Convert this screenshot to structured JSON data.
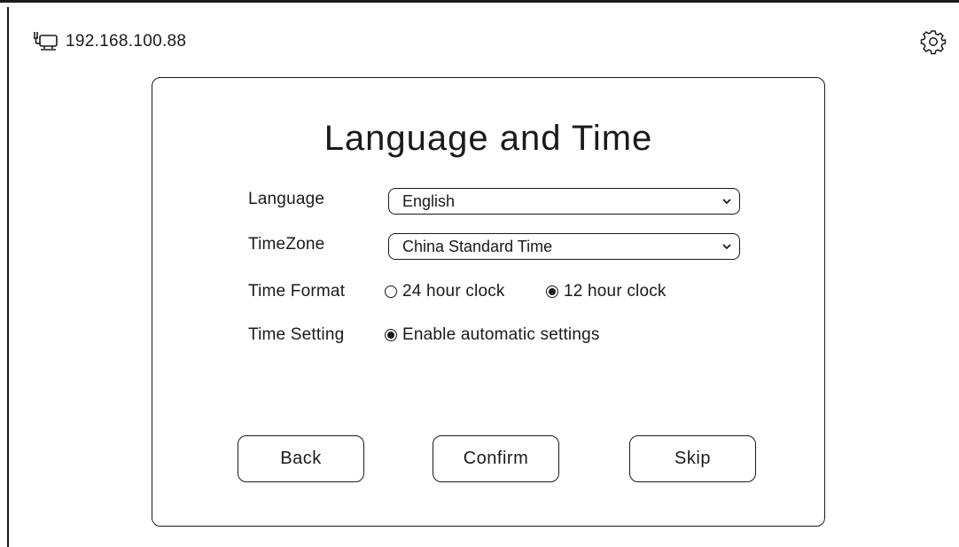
{
  "header": {
    "ip_address": "192.168.100.88",
    "network_icon": "wired-network-icon",
    "settings_icon": "gear-icon"
  },
  "dialog": {
    "title": "Language and Time",
    "language": {
      "label": "Language",
      "value": "English"
    },
    "timezone": {
      "label": "TimeZone",
      "value": "China Standard Time"
    },
    "time_format": {
      "label": "Time Format",
      "options": [
        {
          "label": "24 hour clock",
          "selected": false
        },
        {
          "label": "12 hour clock",
          "selected": true
        }
      ]
    },
    "time_setting": {
      "label": "Time Setting",
      "options": [
        {
          "label": "Enable automatic settings",
          "selected": true
        }
      ]
    },
    "buttons": {
      "back": "Back",
      "confirm": "Confirm",
      "skip": "Skip"
    }
  },
  "colors": {
    "ink": "#1a1a1a",
    "background": "#ffffff"
  }
}
